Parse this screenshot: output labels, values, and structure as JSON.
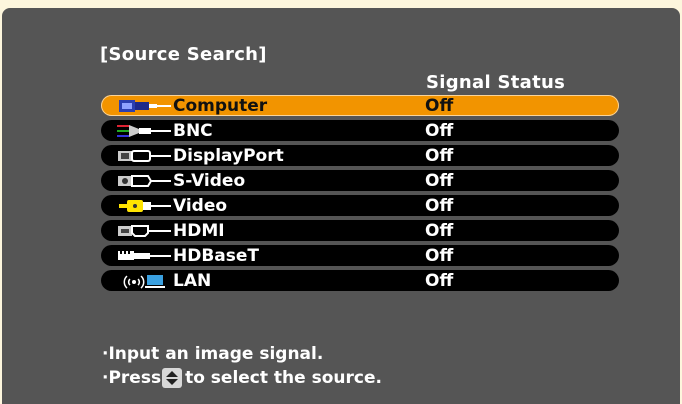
{
  "menu": {
    "title": "[Source Search]",
    "column_header": "Signal Status",
    "selected_index": 0,
    "sources": [
      {
        "label": "Computer",
        "status": "Off",
        "icon": "computer-port-icon"
      },
      {
        "label": "BNC",
        "status": "Off",
        "icon": "bnc-cable-icon"
      },
      {
        "label": "DisplayPort",
        "status": "Off",
        "icon": "displayport-icon"
      },
      {
        "label": "S-Video",
        "status": "Off",
        "icon": "svideo-icon"
      },
      {
        "label": "Video",
        "status": "Off",
        "icon": "composite-video-icon"
      },
      {
        "label": "HDMI",
        "status": "Off",
        "icon": "hdmi-icon"
      },
      {
        "label": "HDBaseT",
        "status": "Off",
        "icon": "hdbaset-icon"
      },
      {
        "label": "LAN",
        "status": "Off",
        "icon": "lan-wireless-icon"
      }
    ]
  },
  "notes": {
    "line1": "·Input an image signal.",
    "line2_prefix": "·Press",
    "line2_suffix": "to select the source.",
    "button_icon": "up-down-arrow-icon"
  },
  "colors": {
    "background": "#fdf6dd",
    "panel": "#555555",
    "row": "#000000",
    "selected_row": "#f29400",
    "text": "#ffffff"
  }
}
